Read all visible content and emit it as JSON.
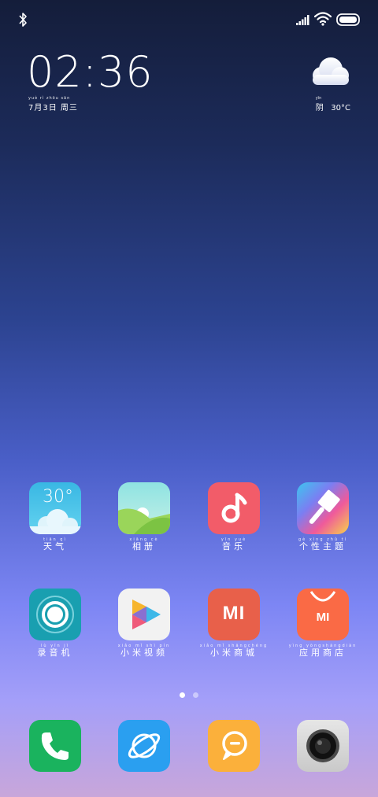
{
  "status_bar": {
    "left_icons": [
      "bluetooth-icon"
    ],
    "right_icons": [
      "signal-icon",
      "wifi-icon",
      "battery-icon"
    ]
  },
  "clock": {
    "time": "02:36"
  },
  "date": {
    "pinyin": "yuè  rì   zhōu sān",
    "text": "7月3日  周三"
  },
  "weather": {
    "icon": "cloud-icon",
    "pinyin": "yīn",
    "condition": "阴",
    "temperature": "30°C"
  },
  "apps": [
    {
      "name": "天气",
      "pinyin": "tiān  qì",
      "icon": "weather-app-icon",
      "tile_text": "30°"
    },
    {
      "name": "相册",
      "pinyin": "xiāng cè",
      "icon": "gallery-app-icon"
    },
    {
      "name": "音乐",
      "pinyin": "yīn  yuè",
      "icon": "music-app-icon"
    },
    {
      "name": "个性主题",
      "pinyin": "gè xìng zhǔ tí",
      "icon": "themes-app-icon"
    },
    {
      "name": "录音机",
      "pinyin": "lù yīn jī",
      "icon": "recorder-app-icon"
    },
    {
      "name": "小米视频",
      "pinyin": "xiǎo mǐ shì pín",
      "icon": "video-app-icon"
    },
    {
      "name": "小米商城",
      "pinyin": "xiǎo mǐ shāngchéng",
      "icon": "mi-store-app-icon",
      "tile_text": "MI"
    },
    {
      "name": "应用商店",
      "pinyin": "yìng yòngshāngdiàn",
      "icon": "app-store-app-icon",
      "tile_text": "MI"
    }
  ],
  "page_indicator": {
    "current_page": 1,
    "total_pages": 2
  },
  "dock": [
    "phone-icon",
    "browser-icon",
    "messages-icon",
    "camera-icon"
  ],
  "colors": {
    "weather": "#3fc4e6",
    "gallery": "#a4e4e2",
    "music": "#f25c69",
    "recorder": "#199fb0",
    "video": "#f2f2f2",
    "mi_store": "#e8604a",
    "app_store": "#fa6a45",
    "phone": "#1ab35e",
    "browser": "#2a9ff0",
    "messages": "#fbb03b",
    "camera": "#d9d9d9"
  }
}
